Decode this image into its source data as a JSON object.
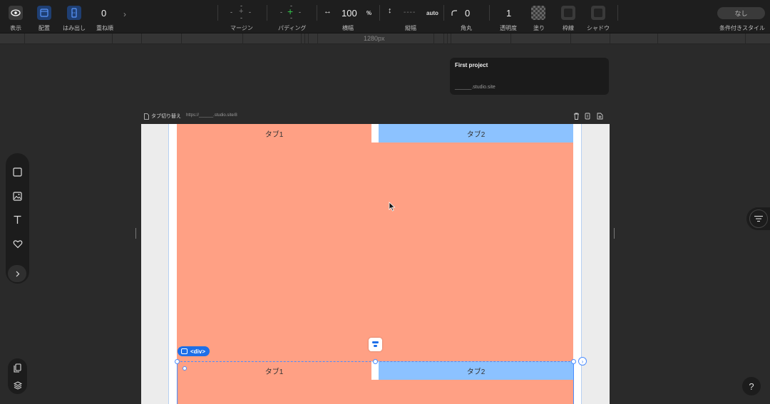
{
  "toolbar": {
    "view_label": "表示",
    "layout_label": "配置",
    "overflow_label": "はみ出し",
    "zindex_value": "0",
    "zindex_label": "重ね順",
    "margin_label": "マージン",
    "margin_placeholder": "-",
    "padding_label": "パディング",
    "width_value": "100",
    "width_unit": "%",
    "width_label": "横幅",
    "height_value": "----",
    "height_unit": "auto",
    "height_label": "縦幅",
    "radius_value": "0",
    "radius_label": "角丸",
    "opacity_value": "1",
    "opacity_label": "透明度",
    "fill_label": "塗り",
    "border_label": "枠線",
    "shadow_label": "シャドウ",
    "conditional_value": "なし",
    "conditional_label": "条件付きスタイル"
  },
  "ruler": {
    "label": "1280px"
  },
  "project": {
    "title": "First project",
    "url": "______.studio.site"
  },
  "page": {
    "name": "タブ切り替え",
    "url": "https://______.studio.site/8"
  },
  "canvas": {
    "tabs_top": {
      "tab1": "タブ1",
      "tab2": "タブ2"
    },
    "tabs_bottom": {
      "tab1": "タブ1",
      "tab2": "タブ2"
    },
    "selection_badge": "<div>"
  },
  "help": {
    "label": "?"
  },
  "colors": {
    "tab_orange": "#ffa084",
    "tab_blue": "#8cc2ff",
    "selection_blue": "#1e6fe8"
  }
}
